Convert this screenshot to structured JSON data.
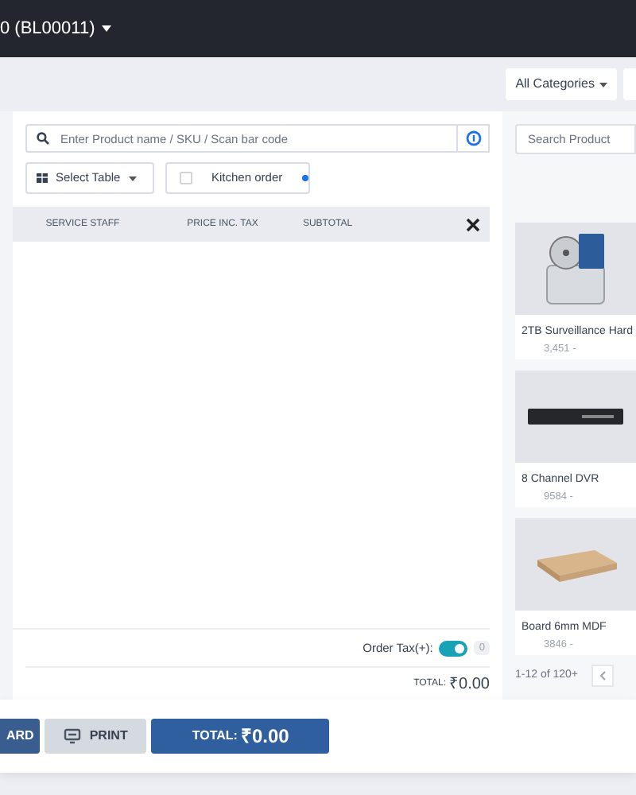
{
  "header": {
    "title": "0 (BL00011)"
  },
  "toolbar": {
    "category_filter": "All Categories"
  },
  "order_panel": {
    "search": {
      "placeholder": "Enter Product name / SKU / Scan bar code"
    },
    "select_table": "Select Table",
    "kitchen_order": {
      "label": "Kitchen order",
      "checked": false
    },
    "table": {
      "columns": [
        "SERVICE STAFF",
        "PRICE INC. TAX",
        "SUBTOTAL"
      ]
    },
    "order_tax": {
      "label": "Order Tax(+):",
      "on": true,
      "value": "0"
    },
    "total": {
      "label": "TOTAL:",
      "value": "₹0.00"
    }
  },
  "products": {
    "search": {
      "placeholder": "Search Product"
    },
    "items": [
      {
        "name": "2TB Surveillance Hard",
        "price": "3,451 -",
        "kind": "drive"
      },
      {
        "name": "8 Channel DVR",
        "price": "9584 -",
        "kind": "dvr"
      },
      {
        "name": "Board 6mm MDF",
        "price": "3846 -",
        "kind": "board"
      }
    ],
    "pagination": "1-12 of 120+"
  },
  "actions": [
    {
      "label": "ARD",
      "kind": "card"
    },
    {
      "label": "PRINT",
      "kind": "print"
    },
    {
      "label": "TOTAL:",
      "value": "₹0.00",
      "kind": "total"
    }
  ]
}
